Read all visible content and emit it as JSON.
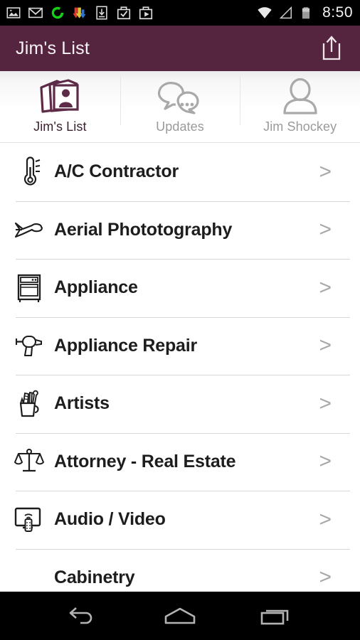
{
  "status_bar": {
    "time": "8:50",
    "left_icons": [
      {
        "name": "gallery-icon"
      },
      {
        "name": "gmail-icon"
      },
      {
        "name": "chrome-c-icon"
      },
      {
        "name": "downloads-arrows-icon"
      },
      {
        "name": "download-box-icon"
      },
      {
        "name": "play-store-check-icon"
      },
      {
        "name": "play-store-video-icon"
      }
    ],
    "right_icons": [
      {
        "name": "wifi-icon"
      },
      {
        "name": "cell-signal-icon"
      },
      {
        "name": "battery-icon"
      }
    ],
    "colors": {
      "background": "#000000",
      "text": "#f2f2f2"
    }
  },
  "header": {
    "title": "Jim's List",
    "share_label": "Share",
    "colors": {
      "background": "#55243f",
      "text": "#f7f2f5"
    }
  },
  "tabs": [
    {
      "label": "Jim's List",
      "icon": "photo-stack-person-icon",
      "active": true
    },
    {
      "label": "Updates",
      "icon": "chat-bubbles-icon",
      "active": false
    },
    {
      "label": "Jim Shockey",
      "icon": "person-silhouette-icon",
      "active": false
    }
  ],
  "list": {
    "chevron": ">",
    "items": [
      {
        "label": "A/C Contractor",
        "icon": "thermometer-icon"
      },
      {
        "label": "Aerial Phototography",
        "icon": "airplane-icon"
      },
      {
        "label": "Appliance",
        "icon": "oven-stove-icon"
      },
      {
        "label": "Appliance Repair",
        "icon": "power-drill-icon"
      },
      {
        "label": "Artists",
        "icon": "pencil-cup-icon"
      },
      {
        "label": "Attorney - Real Estate",
        "icon": "scales-of-justice-icon"
      },
      {
        "label": "Audio / Video",
        "icon": "tv-remote-icon"
      },
      {
        "label": "Cabinetry",
        "icon": "none"
      }
    ]
  },
  "nav_bar": {
    "back_label": "Back",
    "home_label": "Home",
    "recents_label": "Recent apps",
    "colors": {
      "background": "#000000",
      "icon": "#b3b3b3"
    }
  },
  "colors": {
    "accent_purple": "#55243f",
    "tab_icon_purple": "#5d2a47",
    "divider": "#d8d8d8",
    "row_text": "#1d1d1d",
    "muted_text": "#9a9a9a",
    "chevron": "#a8a8a8"
  }
}
